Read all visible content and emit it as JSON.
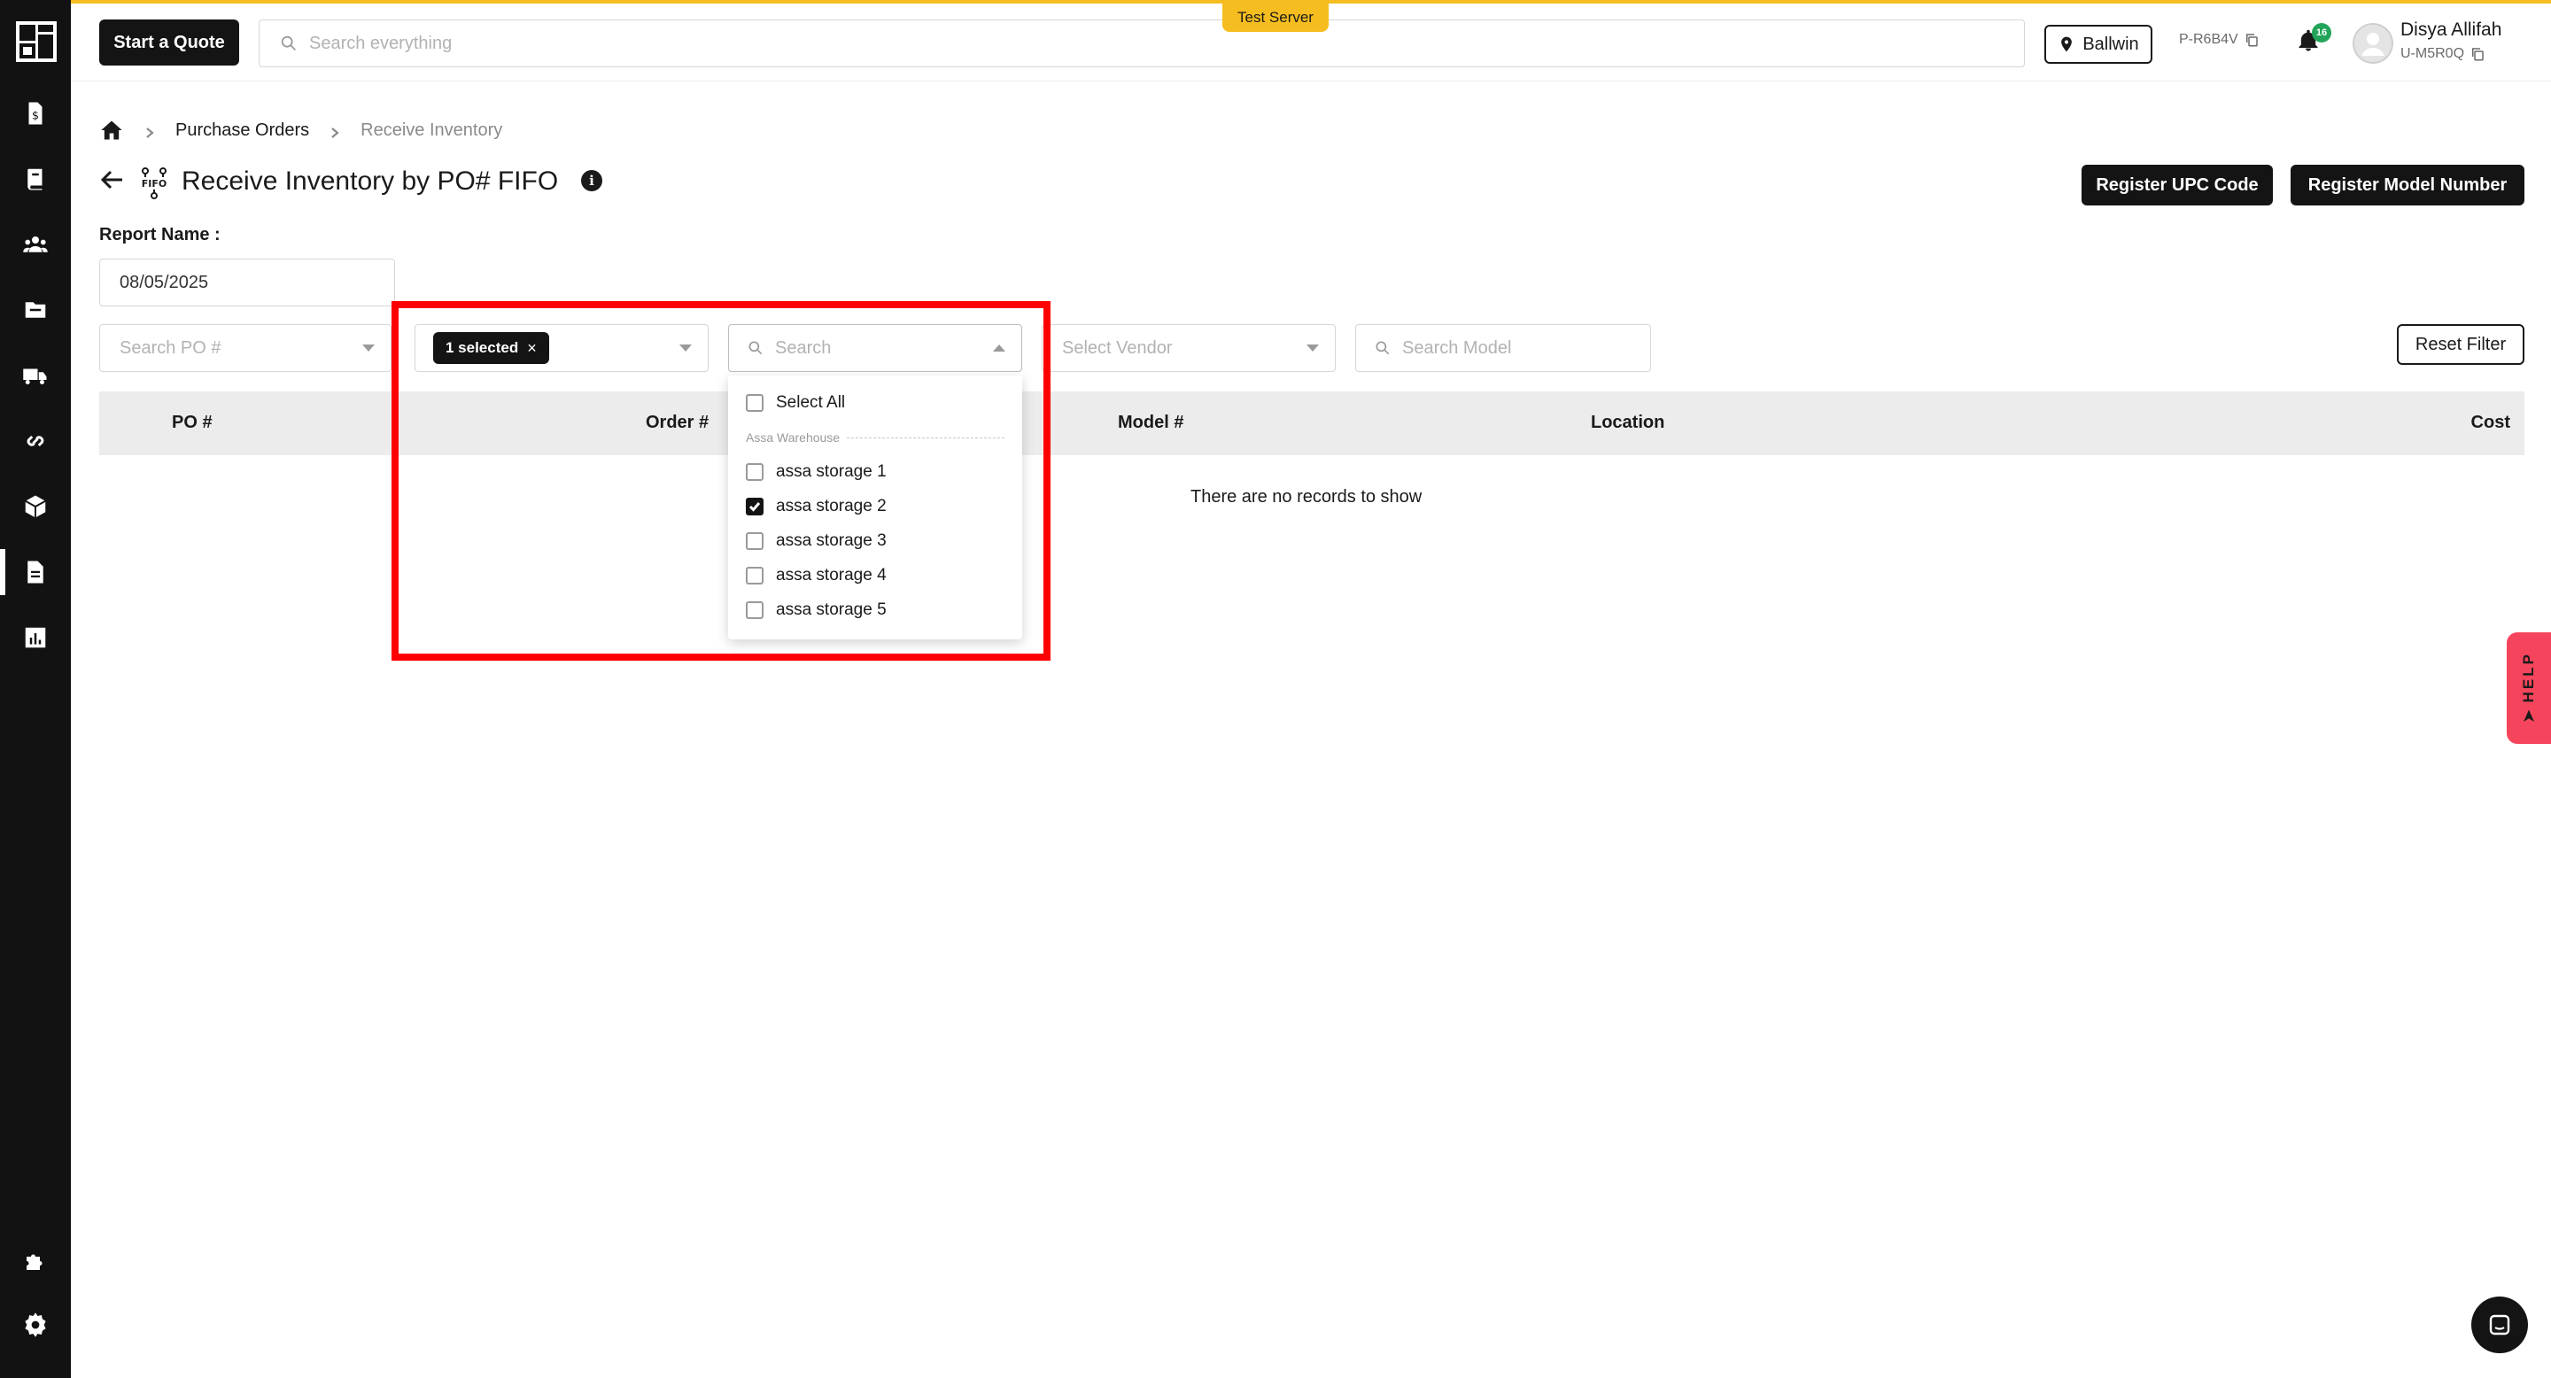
{
  "header": {
    "quote_button": "Start a Quote",
    "search_placeholder": "Search everything",
    "server_badge": "Test Server",
    "location": "Ballwin",
    "account_code": "P-R6B4V",
    "notification_count": "16",
    "user_name": "Disya Allifah",
    "user_code": "U-M5R0Q"
  },
  "breadcrumb": {
    "items": [
      "Purchase Orders",
      "Receive Inventory"
    ]
  },
  "page": {
    "title": "Receive Inventory by PO# FIFO",
    "fifo_label": "FIFO",
    "register_upc": "Register UPC Code",
    "register_model": "Register Model Number",
    "report_label": "Report Name :",
    "report_value": "08/05/2025"
  },
  "filters": {
    "po_placeholder": "Search PO #",
    "location_chip": "1 selected",
    "search_placeholder": "Search",
    "vendor_placeholder": "Select Vendor",
    "model_placeholder": "Search Model",
    "reset": "Reset Filter"
  },
  "dropdown": {
    "select_all": "Select All",
    "group": "Assa Warehouse",
    "options": [
      {
        "label": "assa storage 1",
        "checked": false
      },
      {
        "label": "assa storage 2",
        "checked": true
      },
      {
        "label": "assa storage 3",
        "checked": false
      },
      {
        "label": "assa storage 4",
        "checked": false
      },
      {
        "label": "assa storage 5",
        "checked": false
      }
    ]
  },
  "table": {
    "columns": [
      "PO #",
      "Order #",
      "Model #",
      "Location",
      "Cost"
    ],
    "empty_message": "There are no records to show"
  },
  "help": "HELP",
  "colors": {
    "accent": "#f5bd1f",
    "sidebar": "#121212",
    "highlight": "#ff0000",
    "help": "#f5455c",
    "badge": "#22a55a"
  }
}
